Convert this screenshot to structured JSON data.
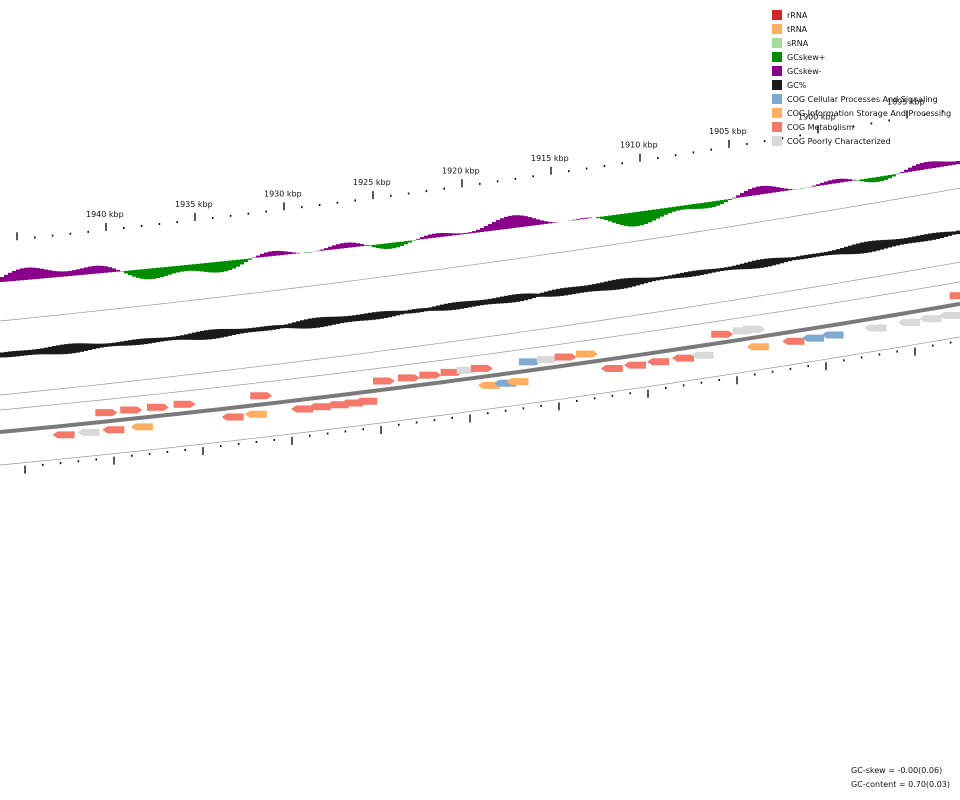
{
  "legend": [
    {
      "label": "rRNA",
      "color": "#d62728"
    },
    {
      "label": "tRNA",
      "color": "#fdae61"
    },
    {
      "label": "sRNA",
      "color": "#a6dba0"
    },
    {
      "label": "GCskew+",
      "color": "#008d00"
    },
    {
      "label": "GCskew-",
      "color": "#8b008b"
    },
    {
      "label": "GC%",
      "color": "#1a1a1a"
    },
    {
      "label": "COG Cellular Processes And Signaling",
      "color": "#7fa9cf"
    },
    {
      "label": "COG Information Storage And Processing",
      "color": "#fdae61"
    },
    {
      "label": "COG Metabolism",
      "color": "#f4796b"
    },
    {
      "label": "COG Poorly Characterized",
      "color": "#d9d9d9"
    }
  ],
  "axis": {
    "unit": "kbp",
    "labels": [
      "1940 kbp",
      "1935 kbp",
      "1930 kbp",
      "1925 kbp",
      "1920 kbp",
      "1915 kbp",
      "1910 kbp",
      "1905 kbp",
      "1900 kbp",
      "1895 kbp"
    ]
  },
  "stats": {
    "gc_skew": "GC-skew = -0.00(0.06)",
    "gc_content": "GC-content = 0.70(0.03)"
  },
  "genes": [
    {
      "kbp": 1943.0,
      "lane": "minus",
      "cog": "Metabolism",
      "dir": "-"
    },
    {
      "kbp": 1941.6,
      "lane": "minus",
      "cog": "Poorly Characterized",
      "dir": "-"
    },
    {
      "kbp": 1940.2,
      "lane": "minus",
      "cog": "Metabolism",
      "dir": "-"
    },
    {
      "kbp": 1938.6,
      "lane": "minus",
      "cog": "Information Storage And Processing",
      "dir": "-"
    },
    {
      "kbp": 1940.6,
      "lane": "plus",
      "cog": "Metabolism",
      "dir": "+"
    },
    {
      "kbp": 1939.2,
      "lane": "plus",
      "cog": "Metabolism",
      "dir": "+"
    },
    {
      "kbp": 1937.7,
      "lane": "plus",
      "cog": "Metabolism",
      "dir": "+"
    },
    {
      "kbp": 1936.2,
      "lane": "plus",
      "cog": "Metabolism",
      "dir": "+"
    },
    {
      "kbp": 1931.9,
      "lane": "plus",
      "cog": "Metabolism",
      "dir": "+"
    },
    {
      "kbp": 1933.5,
      "lane": "minus",
      "cog": "Metabolism",
      "dir": "-"
    },
    {
      "kbp": 1932.2,
      "lane": "minus",
      "cog": "Information Storage And Processing",
      "dir": "-"
    },
    {
      "kbp": 1929.6,
      "lane": "minus",
      "cog": "Metabolism",
      "dir": "-"
    },
    {
      "kbp": 1928.6,
      "lane": "minus",
      "cog": "Metabolism",
      "dir": "-"
    },
    {
      "kbp": 1927.6,
      "lane": "minus",
      "cog": "Metabolism",
      "dir": "-"
    },
    {
      "kbp": 1926.8,
      "lane": "minus",
      "cog": "Metabolism",
      "dir": "-"
    },
    {
      "kbp": 1926.0,
      "lane": "minus",
      "cog": "Metabolism",
      "dir": "-"
    },
    {
      "kbp": 1925.0,
      "lane": "plus",
      "cog": "Metabolism",
      "dir": "+"
    },
    {
      "kbp": 1923.6,
      "lane": "plus",
      "cog": "Metabolism",
      "dir": "+"
    },
    {
      "kbp": 1922.4,
      "lane": "plus",
      "cog": "Metabolism",
      "dir": "+"
    },
    {
      "kbp": 1921.2,
      "lane": "plus",
      "cog": "Metabolism",
      "dir": "+"
    },
    {
      "kbp": 1920.3,
      "lane": "plus",
      "cog": "Poorly Characterized",
      "dir": "+"
    },
    {
      "kbp": 1919.5,
      "lane": "plus",
      "cog": "Metabolism",
      "dir": "+"
    },
    {
      "kbp": 1919.1,
      "lane": "minus",
      "cog": "Information Storage And Processing",
      "dir": "-"
    },
    {
      "kbp": 1918.2,
      "lane": "minus",
      "cog": "Cellular Processes And Signaling",
      "dir": "-"
    },
    {
      "kbp": 1917.5,
      "lane": "minus",
      "cog": "Information Storage And Processing",
      "dir": "-"
    },
    {
      "kbp": 1916.8,
      "lane": "plus",
      "cog": "Cellular Processes And Signaling",
      "dir": "+"
    },
    {
      "kbp": 1915.8,
      "lane": "plus",
      "cog": "Poorly Characterized",
      "dir": "+"
    },
    {
      "kbp": 1914.8,
      "lane": "plus",
      "cog": "Metabolism",
      "dir": "+"
    },
    {
      "kbp": 1913.6,
      "lane": "plus",
      "cog": "Information Storage And Processing",
      "dir": "+"
    },
    {
      "kbp": 1912.2,
      "lane": "minus",
      "cog": "Metabolism",
      "dir": "-"
    },
    {
      "kbp": 1910.9,
      "lane": "minus",
      "cog": "Metabolism",
      "dir": "-"
    },
    {
      "kbp": 1909.6,
      "lane": "minus",
      "cog": "Metabolism",
      "dir": "-"
    },
    {
      "kbp": 1908.2,
      "lane": "minus",
      "cog": "Metabolism",
      "dir": "-"
    },
    {
      "kbp": 1907.1,
      "lane": "minus",
      "cog": "Poorly Characterized",
      "dir": "-"
    },
    {
      "kbp": 1906.0,
      "lane": "plus",
      "cog": "Metabolism",
      "dir": "+"
    },
    {
      "kbp": 1904.8,
      "lane": "plus",
      "cog": "Poorly Characterized",
      "dir": "+"
    },
    {
      "kbp": 1904.2,
      "lane": "plus",
      "cog": "Poorly Characterized",
      "dir": "+"
    },
    {
      "kbp": 1904.0,
      "lane": "minus",
      "cog": "Information Storage And Processing",
      "dir": "-"
    },
    {
      "kbp": 1902.0,
      "lane": "minus",
      "cog": "Metabolism",
      "dir": "-"
    },
    {
      "kbp": 1900.9,
      "lane": "minus",
      "cog": "Cellular Processes And Signaling",
      "dir": "-"
    },
    {
      "kbp": 1899.8,
      "lane": "minus",
      "cog": "Cellular Processes And Signaling",
      "dir": "-"
    },
    {
      "kbp": 1897.4,
      "lane": "minus",
      "cog": "Poorly Characterized",
      "dir": "-"
    },
    {
      "kbp": 1895.5,
      "lane": "minus",
      "cog": "Poorly Characterized",
      "dir": "-"
    },
    {
      "kbp": 1894.3,
      "lane": "minus",
      "cog": "Poorly Characterized",
      "dir": "-"
    },
    {
      "kbp": 1893.2,
      "lane": "minus",
      "cog": "Poorly Characterized",
      "dir": "-"
    },
    {
      "kbp": 1892.6,
      "lane": "plus",
      "cog": "Metabolism",
      "dir": "+"
    },
    {
      "kbp": 1891.2,
      "lane": "plus",
      "cog": "Cellular Processes And Signaling",
      "dir": "+"
    },
    {
      "kbp": 1890.3,
      "lane": "plus",
      "cog": "Cellular Processes And Signaling",
      "dir": "+"
    }
  ]
}
